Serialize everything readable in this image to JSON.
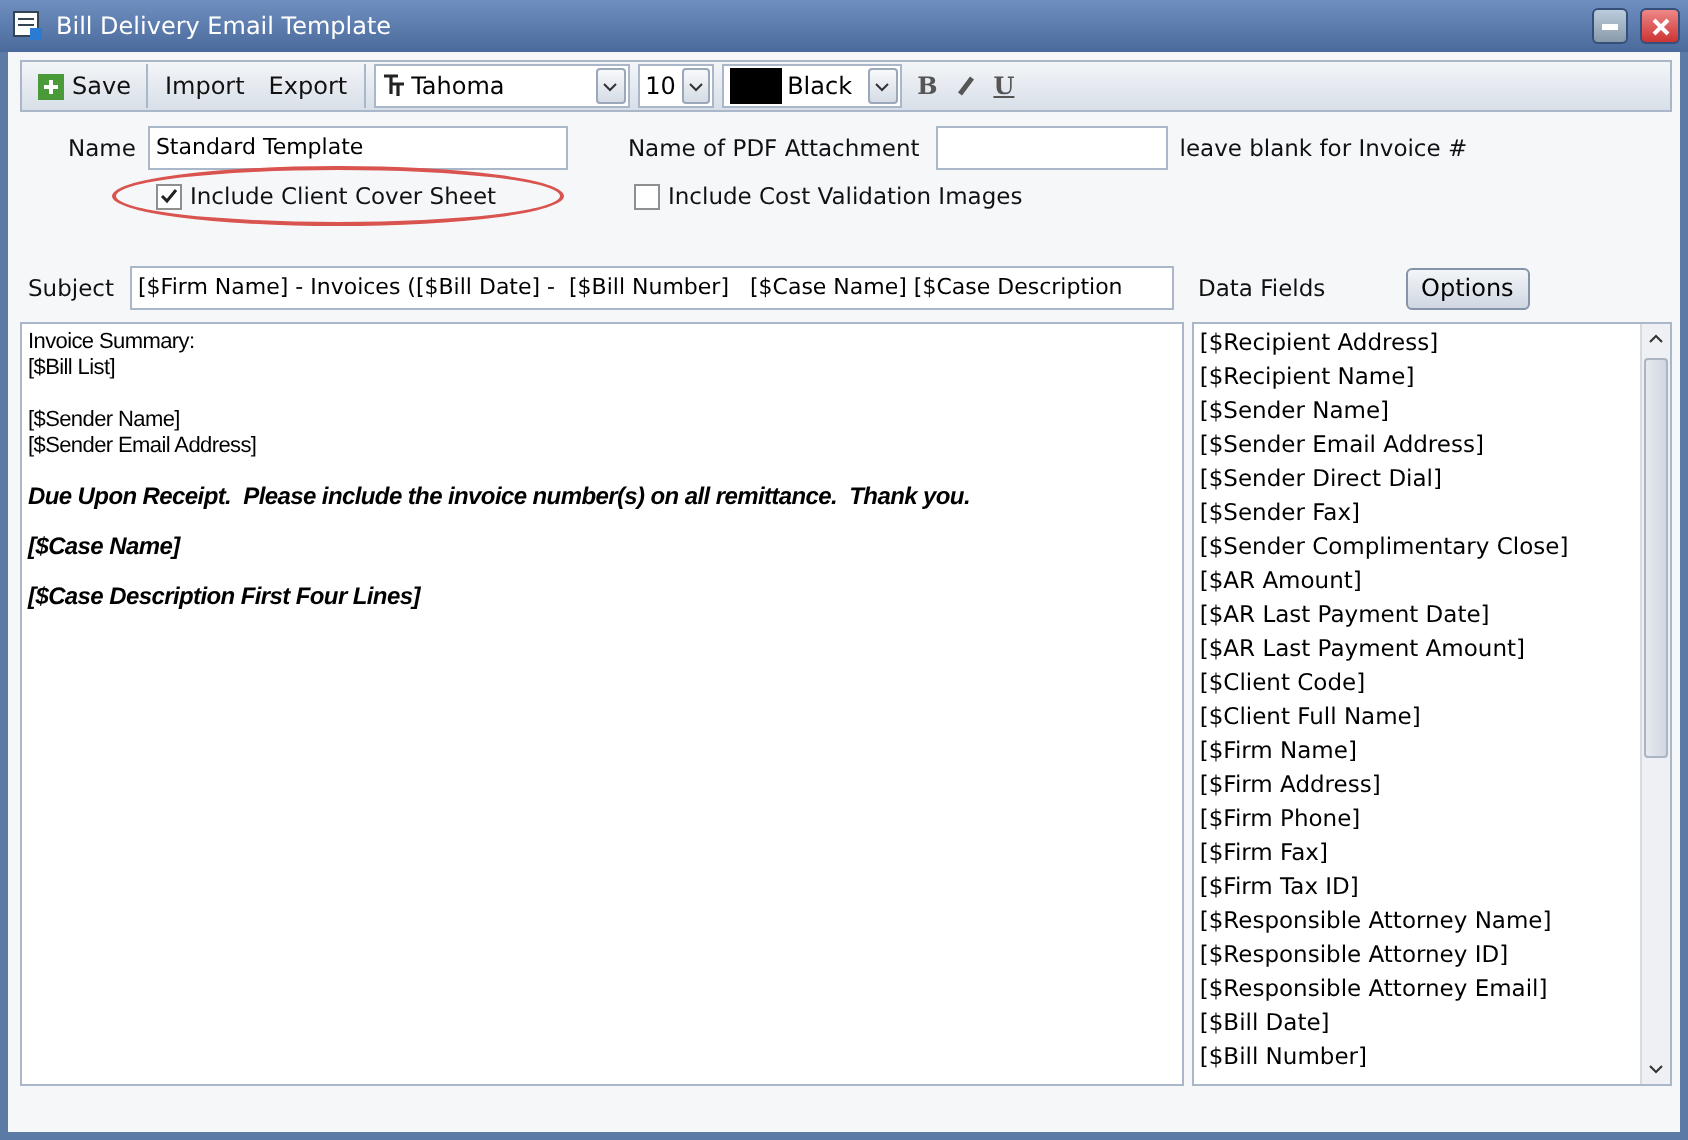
{
  "window": {
    "title": "Bill Delivery Email Template"
  },
  "toolbar": {
    "save": "Save",
    "import": "Import",
    "export": "Export",
    "font": "Tahoma",
    "size": "10",
    "color_name": "Black",
    "color": "#000000",
    "bold": "B",
    "underline": "U"
  },
  "form": {
    "name_label": "Name",
    "name_value": "Standard Template",
    "pdf_label": "Name of PDF Attachment",
    "pdf_hint": "leave blank for Invoice #",
    "cover_sheet": {
      "label": "Include Client Cover Sheet",
      "checked": true,
      "highlighted": true
    },
    "cost_images": {
      "label": "Include Cost Validation Images",
      "checked": false
    },
    "subject_label": "Subject",
    "subject_value": "[$Firm Name] - Invoices ([$Bill Date] -  [$Bill Number]   [$Case Name] [$Case Description"
  },
  "data_fields": {
    "label": "Data Fields",
    "options": "Options",
    "items": [
      "[$Recipient Address]",
      "[$Recipient Name]",
      "[$Sender Name]",
      "[$Sender Email Address]",
      "[$Sender Direct Dial]",
      "[$Sender Fax]",
      "[$Sender Complimentary Close]",
      "[$AR Amount]",
      "[$AR Last Payment Date]",
      "[$AR Last Payment Amount]",
      "[$Client Code]",
      "[$Client Full Name]",
      "[$Firm Name]",
      "[$Firm Address]",
      "[$Firm Phone]",
      "[$Firm Fax]",
      "[$Firm Tax ID]",
      "[$Responsible Attorney Name]",
      "[$Responsible Attorney ID]",
      "[$Responsible Attorney Email]",
      "[$Bill Date]",
      "[$Bill Number]"
    ]
  },
  "body": [
    {
      "kind": "plain",
      "text": "Invoice Summary:"
    },
    {
      "kind": "plain",
      "text": "[$Bill List]"
    },
    {
      "kind": "blank"
    },
    {
      "kind": "plain",
      "text": "[$Sender Name]"
    },
    {
      "kind": "plain",
      "text": "[$Sender Email Address]"
    },
    {
      "kind": "emphasis",
      "text": "Due Upon Receipt.  Please include the invoice number(s) on all remittance.  Thank you."
    },
    {
      "kind": "emphasis",
      "text": "[$Case Name]"
    },
    {
      "kind": "emphasis",
      "text": "[$Case Description First Four Lines]"
    }
  ]
}
